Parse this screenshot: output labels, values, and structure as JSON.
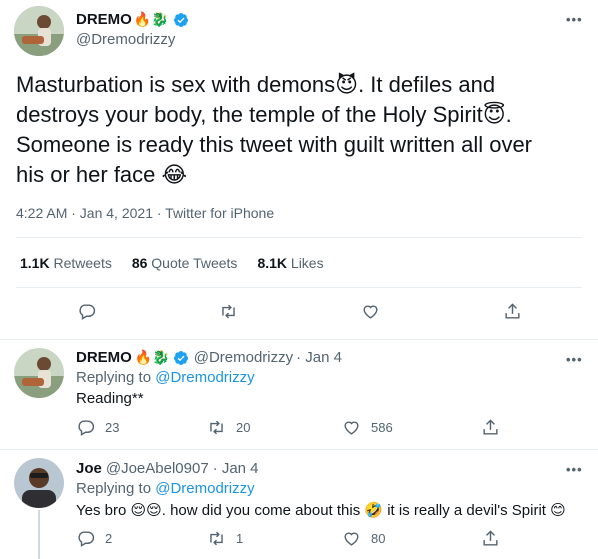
{
  "main_tweet": {
    "display_name": "DREMO",
    "name_emoji": "🔥🐉",
    "handle": "@Dremodrizzy",
    "text_lines": [
      "Masturbation is sex with demons😈. It defiles and",
      "destroys your body, the temple of the Holy Spirit😇.",
      "Someone is ready this tweet with guilt written all over",
      "his or her face 😂"
    ],
    "timestamp": "4:22 AM · Jan 4, 2021 · Twitter for iPhone",
    "stats": {
      "retweets_count": "1.1K",
      "retweets_label": "Retweets",
      "quotes_count": "86",
      "quotes_label": "Quote Tweets",
      "likes_count": "8.1K",
      "likes_label": "Likes"
    },
    "more_label": "•••"
  },
  "reply_1": {
    "display_name": "DREMO",
    "name_emoji": "🔥🐉",
    "handle": "@Dremodrizzy",
    "date": "· Jan 4",
    "replying_prefix": "Replying to",
    "replying_handle": "@Dremodrizzy",
    "text": "Reading**",
    "replies": "23",
    "retweets": "20",
    "likes": "586",
    "more_label": "•••"
  },
  "reply_2": {
    "display_name": "Joe",
    "handle": "@JoeAbel0907",
    "date": "· Jan 4",
    "replying_prefix": "Replying to",
    "replying_handle": "@Dremodrizzy",
    "text": "Yes bro 😌😌. how did you come about this 🤣 it is really a devil's Spirit 😊",
    "replies": "2",
    "retweets": "1",
    "likes": "80",
    "more_label": "•••"
  },
  "colors": {
    "verified": "#1da1f2",
    "link": "#1b95e0",
    "muted": "#536471",
    "divider": "#e6ecf0"
  },
  "icons": [
    "verified-badge-icon",
    "more-icon",
    "reply-icon",
    "retweet-icon",
    "like-icon",
    "share-icon"
  ]
}
